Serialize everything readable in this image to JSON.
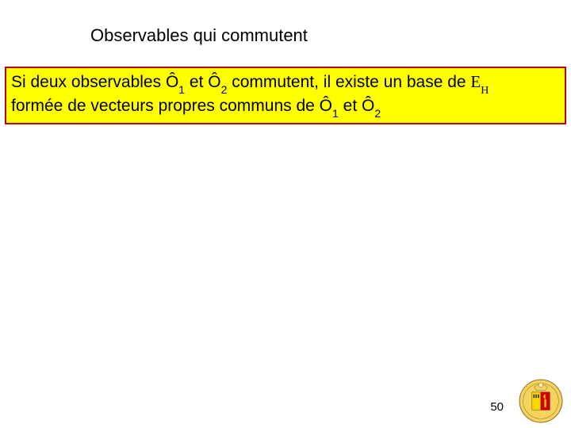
{
  "title": "Observables qui commutent",
  "box": {
    "pre1": "Si deux observables Ô",
    "s1": "1",
    "mid1": " et Ô",
    "s2": "2",
    "mid2": "  commutent, il existe un base de ",
    "eps": "E",
    "epsH": "H",
    "line2a": "formée de vecteurs propres communs de Ô",
    "s3": "1",
    "mid3": " et Ô",
    "s4": "2"
  },
  "pageNumber": "50"
}
